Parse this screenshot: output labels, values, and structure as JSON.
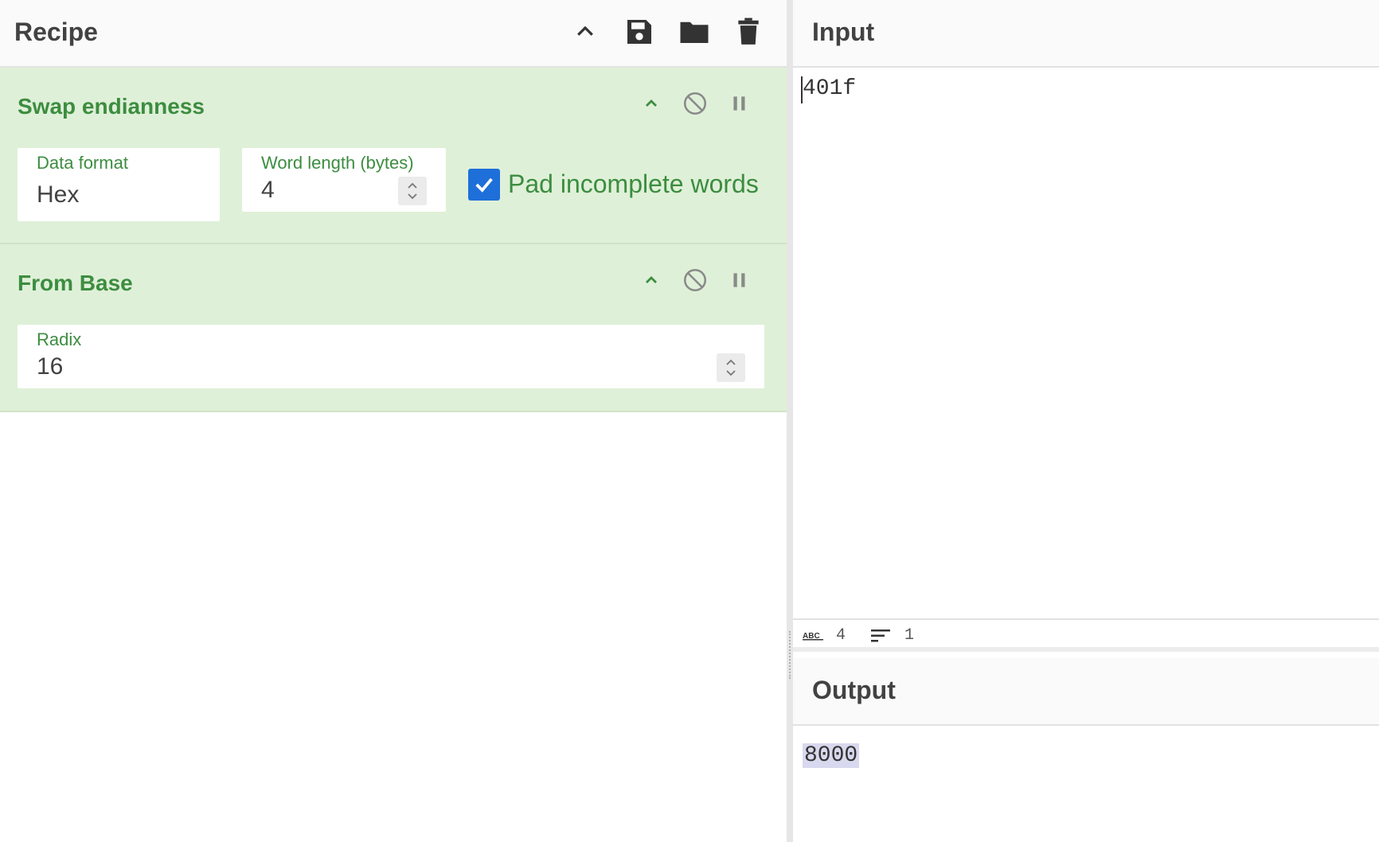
{
  "recipe": {
    "title": "Recipe",
    "actions": [
      "collapse-all",
      "save",
      "load",
      "clear"
    ]
  },
  "operations": [
    {
      "title": "Swap endianness",
      "fields": [
        {
          "label": "Data format",
          "value": "Hex"
        },
        {
          "label": "Word length (bytes)",
          "value": "4"
        }
      ],
      "checkbox": {
        "label": "Pad incomplete words",
        "checked": true
      }
    },
    {
      "title": "From Base",
      "fields": [
        {
          "label": "Radix",
          "value": "16"
        }
      ]
    }
  ],
  "input": {
    "title": "Input",
    "value": "401f",
    "status": {
      "length_icon": "abc-icon",
      "length": "4",
      "lines_icon": "lines-icon",
      "lines": "1"
    }
  },
  "output": {
    "title": "Output",
    "value": "8000"
  },
  "colors": {
    "accent_green": "#3c8d40",
    "op_background": "#dff0d8",
    "checkbox_blue": "#1e6fd9",
    "selection": "#d8d8ee"
  }
}
